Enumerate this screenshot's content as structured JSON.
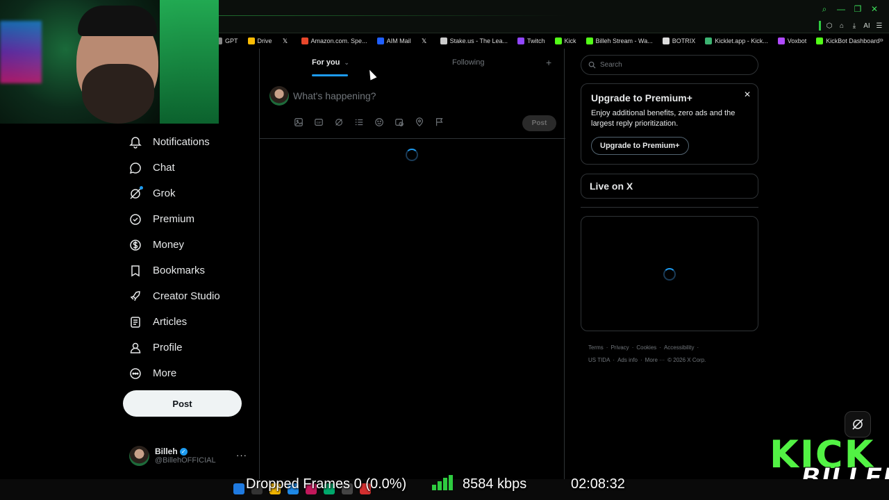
{
  "bookmarks": [
    {
      "label": "GPT",
      "icon": "gpt-icon",
      "color": "#888888"
    },
    {
      "label": "Drive",
      "icon": "drive-icon",
      "color": "#fbbc04"
    },
    {
      "label": "",
      "icon": "x-icon",
      "color": "#ffffff"
    },
    {
      "label": "Amazon.com. Spe...",
      "icon": "amazon-icon",
      "color": "#e8472b"
    },
    {
      "label": "AIM Mail",
      "icon": "aim-icon",
      "color": "#1f5fff"
    },
    {
      "label": "",
      "icon": "x-icon",
      "color": "#ffffff"
    },
    {
      "label": "Stake.us - The Lea...",
      "icon": "stake-icon",
      "color": "#cccccc"
    },
    {
      "label": "Twitch",
      "icon": "twitch-icon",
      "color": "#9146ff"
    },
    {
      "label": "Kick",
      "icon": "kick-icon",
      "color": "#53fc18"
    },
    {
      "label": "Billeh Stream - Wa...",
      "icon": "kick-icon",
      "color": "#53fc18"
    },
    {
      "label": "BOTRIX",
      "icon": "botrix-icon",
      "color": "#dddddd"
    },
    {
      "label": "Kicklet.app - Kick...",
      "icon": "kicklet-icon",
      "color": "#3cb371"
    },
    {
      "label": "Voxbot",
      "icon": "voxbot-icon",
      "color": "#b04aff"
    },
    {
      "label": "KickBot Dashboard",
      "icon": "kickbot-icon",
      "color": "#53fc18"
    }
  ],
  "extensions": {
    "ai_label": "AI"
  },
  "nav": {
    "items": [
      {
        "label": "Notifications",
        "icon": "bell-icon"
      },
      {
        "label": "Chat",
        "icon": "chat-icon"
      },
      {
        "label": "Grok",
        "icon": "grok-icon"
      },
      {
        "label": "Premium",
        "icon": "premium-icon"
      },
      {
        "label": "Money",
        "icon": "money-icon"
      },
      {
        "label": "Bookmarks",
        "icon": "bookmark-icon"
      },
      {
        "label": "Creator Studio",
        "icon": "rocket-icon"
      },
      {
        "label": "Articles",
        "icon": "articles-icon"
      },
      {
        "label": "Profile",
        "icon": "profile-icon"
      },
      {
        "label": "More",
        "icon": "more-circle-icon"
      }
    ],
    "post_label": "Post"
  },
  "account": {
    "name": "Billeh",
    "handle": "@BillehOFFICIAL",
    "more": "···"
  },
  "feed": {
    "tabs": [
      {
        "label": "For you"
      },
      {
        "label": "Following"
      }
    ],
    "plus": "+",
    "composer_placeholder": "What's happening?",
    "post_label": "Post"
  },
  "right": {
    "search_placeholder": "Search",
    "premium": {
      "title": "Upgrade to Premium+",
      "desc": "Enjoy additional benefits, zero ads and the largest reply prioritization.",
      "button": "Upgrade to Premium+"
    },
    "live_title": "Live on X",
    "footer": {
      "links": [
        "Terms",
        "·",
        "Privacy",
        "·",
        "Cookies",
        "·",
        "Accessibility",
        "·"
      ],
      "links2": [
        "US TIDA",
        "·",
        "Ads info",
        "·",
        "More ···",
        "© 2026 X Corp."
      ]
    }
  },
  "overlay": {
    "kick": "KICK",
    "billeh": "BILLEH",
    "dropped_frames": "Dropped Frames 0 (0.0%)",
    "bitrate": "8584 kbps",
    "uptime": "02:08:32"
  },
  "colors": {
    "accent": "#1d9bf0",
    "kick_green": "#53fc18"
  }
}
